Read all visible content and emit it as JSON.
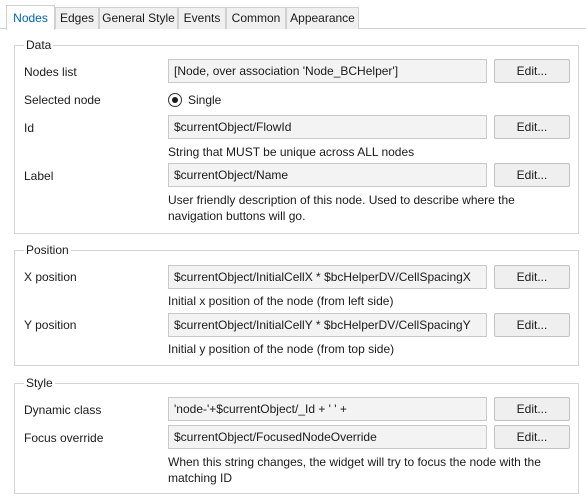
{
  "tabs": [
    {
      "label": "Nodes",
      "active": true
    },
    {
      "label": "Edges",
      "active": false
    },
    {
      "label": "General Style",
      "active": false
    },
    {
      "label": "Events",
      "active": false
    },
    {
      "label": "Common",
      "active": false
    },
    {
      "label": "Appearance",
      "active": false
    }
  ],
  "data_group": {
    "title": "Data",
    "nodes_list": {
      "label": "Nodes list",
      "value": "[Node, over association 'Node_BCHelper']",
      "button": "Edit..."
    },
    "selected_node": {
      "label": "Selected node",
      "option": "Single",
      "selected": true
    },
    "id": {
      "label": "Id",
      "value": "$currentObject/FlowId",
      "button": "Edit...",
      "help": "String that MUST be unique across ALL nodes"
    },
    "label": {
      "label": "Label",
      "value": "$currentObject/Name",
      "button": "Edit...",
      "help_line1": "User friendly description of this node. Used to describe where the",
      "help_line2": "navigation buttons will go."
    }
  },
  "position_group": {
    "title": "Position",
    "x": {
      "label": "X position",
      "value": "$currentObject/InitialCellX * $bcHelperDV/CellSpacingX",
      "button": "Edit...",
      "help": "Initial x position of the node (from left side)"
    },
    "y": {
      "label": "Y position",
      "value": "$currentObject/InitialCellY * $bcHelperDV/CellSpacingY",
      "button": "Edit...",
      "help": "Initial y position of the node (from top side)"
    }
  },
  "style_group": {
    "title": "Style",
    "dynamic_class": {
      "label": "Dynamic class",
      "value": "'node-'+$currentObject/_Id + ' ' +",
      "button": "Edit..."
    },
    "focus_override": {
      "label": "Focus override",
      "value": "$currentObject/FocusedNodeOverride",
      "button": "Edit...",
      "help_line1": "When this string changes, the widget will try to focus the node with the",
      "help_line2": "matching ID"
    }
  }
}
